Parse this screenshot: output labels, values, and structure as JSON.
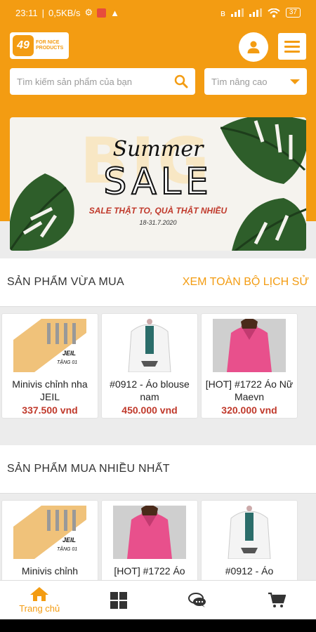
{
  "status_bar": {
    "time": "23:11",
    "speed": "0,5KB/s",
    "battery": "37"
  },
  "header": {
    "logo_number": "49",
    "logo_text": "FOR NICE PRODUCTS",
    "search_placeholder": "Tìm kiếm sản phẩm của bạn",
    "advanced_search_label": "Tìm nâng cao",
    "brand_color": "#f39c12"
  },
  "banner": {
    "background_word": "BIG",
    "title_script": "Summer",
    "title_main": "SALE",
    "tagline": "SALE THẬT TO, QUÀ THẬT NHIỀU",
    "dates": "18-31.7.2020"
  },
  "recent": {
    "title": "SẢN PHẨM VỪA MUA",
    "link": "XEM TOÀN BỘ LỊCH SỬ",
    "items": [
      {
        "name": "Minivis chỉnh nha JEIL",
        "price": "337.500 vnd",
        "image": "screws"
      },
      {
        "name": "#0912 - Áo blouse nam",
        "price": "450.000 vnd",
        "image": "white-coat"
      },
      {
        "name": "[HOT] #1722 Áo Nữ Maevn",
        "price": "320.000 vnd",
        "image": "pink-scrubs"
      }
    ]
  },
  "popular": {
    "title": "SẢN PHẨM MUA NHIỀU NHẤT",
    "items": [
      {
        "name": "Minivis chỉnh",
        "image": "screws"
      },
      {
        "name": "[HOT] #1722 Áo",
        "image": "pink-scrubs"
      },
      {
        "name": "#0912 - Áo",
        "image": "white-coat"
      }
    ]
  },
  "bottom_nav": {
    "home": "Trang chủ"
  }
}
